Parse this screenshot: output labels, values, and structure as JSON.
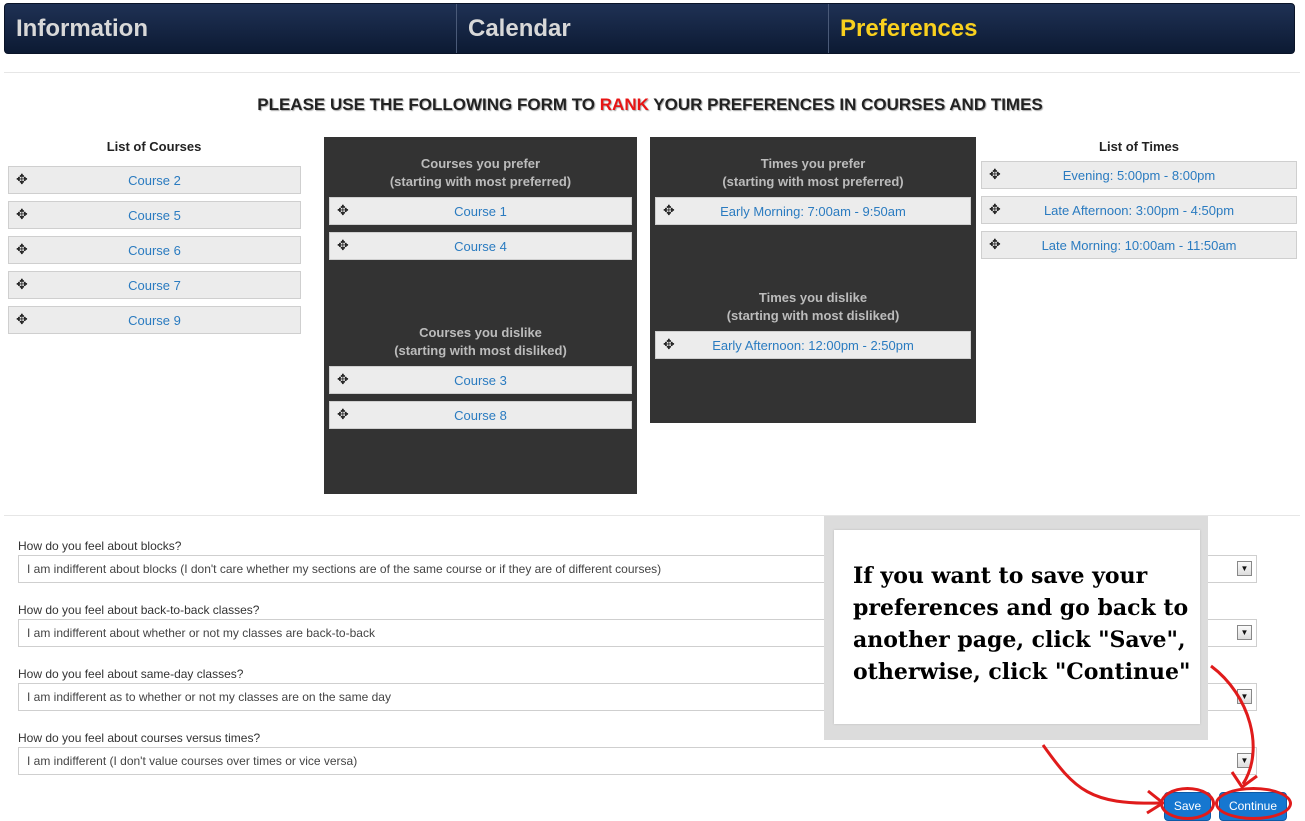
{
  "nav": {
    "tabs": [
      {
        "label": "Information",
        "active": false
      },
      {
        "label": "Calendar",
        "active": false
      },
      {
        "label": "Preferences",
        "active": true
      }
    ],
    "active_color": "#f9d01e"
  },
  "heading": {
    "before": "PLEASE USE THE FOLLOWING FORM TO ",
    "highlight": "RANK",
    "after": " YOUR PREFERENCES IN COURSES AND TIMES"
  },
  "courses": {
    "title": "List of Courses",
    "items": [
      "Course 2",
      "Course 5",
      "Course 6",
      "Course 7",
      "Course 9"
    ]
  },
  "courses_prefer": {
    "title_line1": "Courses you prefer",
    "title_line2": "(starting with most preferred)",
    "items": [
      "Course 1",
      "Course 4"
    ]
  },
  "courses_dislike": {
    "title_line1": "Courses you dislike",
    "title_line2": "(starting with most disliked)",
    "items": [
      "Course 3",
      "Course 8"
    ]
  },
  "times_prefer": {
    "title_line1": "Times you prefer",
    "title_line2": "(starting with most preferred)",
    "items": [
      "Early Morning: 7:00am - 9:50am"
    ]
  },
  "times_dislike": {
    "title_line1": "Times you dislike",
    "title_line2": "(starting with most disliked)",
    "items": [
      "Early Afternoon: 12:00pm - 2:50pm"
    ]
  },
  "times": {
    "title": "List of Times",
    "items": [
      "Evening: 5:00pm - 8:00pm",
      "Late Afternoon: 3:00pm - 4:50pm",
      "Late Morning: 10:00am - 11:50am"
    ]
  },
  "questions": [
    {
      "label": "How do you feel about blocks?",
      "value": "I am indifferent about blocks (I don't care whether my sections are of the same course or if they are of different courses)"
    },
    {
      "label": "How do you feel about back-to-back classes?",
      "value": "I am indifferent about whether or not my classes are back-to-back"
    },
    {
      "label": "How do you feel about same-day classes?",
      "value": "I am indifferent as to whether or not my classes are on the same day"
    },
    {
      "label": "How do you feel about courses versus times?",
      "value": "I am indifferent (I don't value courses over times or vice versa)"
    }
  ],
  "callout": {
    "text": "If you want to save your preferences and go back to another page, click \"Save\", otherwise, click \"Continue\""
  },
  "buttons": {
    "save": "Save",
    "continue": "Continue"
  },
  "icons": {
    "move": "move-icon",
    "select_arrow": "dropdown-arrow-icon"
  },
  "colors": {
    "nav_bg": "#16294a",
    "panel_bg": "#333333",
    "link": "#2a7bc0",
    "rank": "#e81414",
    "button": "#1677d0",
    "annotation": "#e01b1b"
  }
}
